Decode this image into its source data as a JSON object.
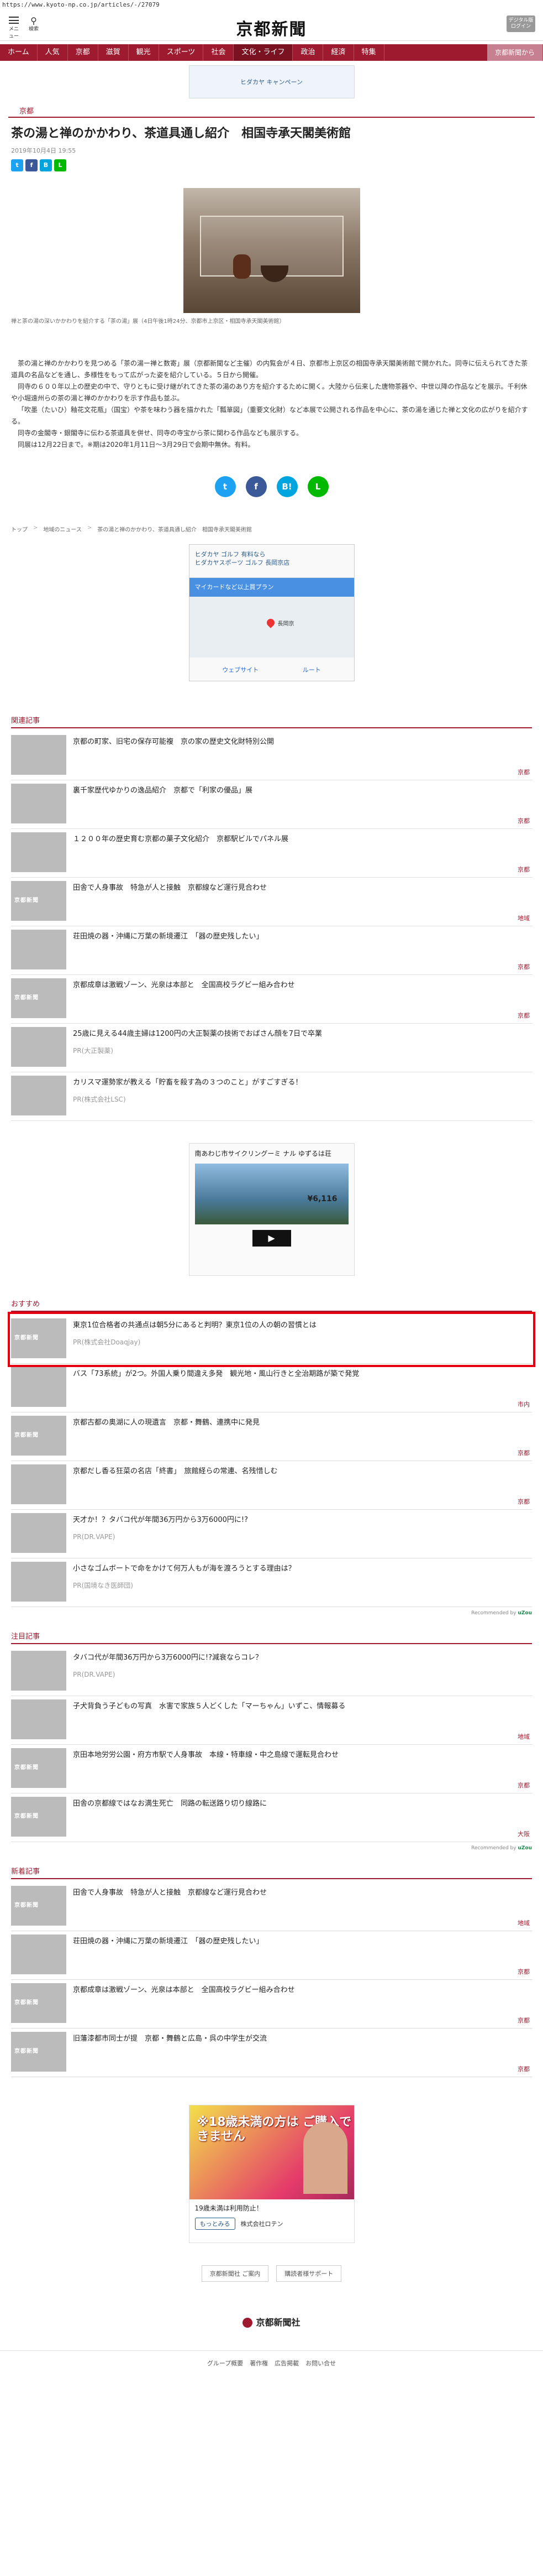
{
  "url": "https://www.kyoto-np.co.jp/articles/-/27079",
  "header": {
    "menu_label": "メニュー",
    "search_label": "検索",
    "logo": "京都新聞",
    "digital_label": "デジタル版 ログイン"
  },
  "nav": [
    "ホーム",
    "人気",
    "京都",
    "滋賀",
    "観光",
    "スポーツ",
    "社会",
    "文化・ライフ",
    "政治",
    "経済",
    "特集",
    "京都新聞から"
  ],
  "nav_active": 7,
  "top_banner": "ヒダカヤ キャンペーン",
  "section_label": "京都",
  "article": {
    "title": "茶の湯と禅のかかわり、茶道具通し紹介　相国寺承天閣美術館",
    "date": "2019年10月4日 19:55",
    "caption": "禅と茶の湯の深いかかわりを紹介する「茶の湯」展（4日午後1時24分、京都市上京区・相国寺承天閣美術館）",
    "paragraphs": [
      "茶の湯と禅のかかわりを見つめる「茶の湯ー禅と数寄」展（京都新聞など主催）の内覧会が４日、京都市上京区の相国寺承天閣美術館で開かれた。同寺に伝えられてきた茶道具の名品などを通し、多様性をもって広がった姿を紹介している。５日から開催。",
      "同寺の６００年以上の歴史の中で、守りともに受け継がれてきた茶の湯のあり方を紹介するために開く。大陸から伝来した唐物茶器や、中世以降の作品などを展示。千利休や小堀遠州らの茶の湯と禅のかかわりを示す作品も並ぶ。",
      "「吹墨（たいひ）釉花文花瓶」（国宝）や茶を味わう器を描かれた「瓢箪図」（重要文化財）など本展で公開される作品を中心に、茶の湯を通じた禅と文化の広がりを紹介する。",
      "同寺の金閣寺・銀閣寺に伝わる茶道具を併せ、同寺の寺宝から茶に関わる作品なども展示する。",
      "同展は12月22日まで。※期は2020年1月11日～3月29日で会期中無休。有料。"
    ]
  },
  "breadcrumb": [
    "トップ",
    "地域のニュース",
    "茶の湯と禅のかかわり、茶道具通し紹介　相国寺承天閣美術館"
  ],
  "ad_map": {
    "line1": "ヒダカヤ ゴルフ 有料なら",
    "line2": "ヒダカヤスポーツ ゴルフ 長岡京店",
    "blue": "マイカードなど以上買プラン",
    "map_label": "長岡京",
    "btn1": "ウェブサイト",
    "btn2": "ルート"
  },
  "related": {
    "title": "関連記事",
    "items": [
      {
        "text": "京都の町家、旧宅の保存可能複　京の家の歴史文化財特別公開",
        "cat": "京都",
        "thumb": "a"
      },
      {
        "text": "裏千家歴代ゆかりの逸品紹介　京都で「利家の優品」展",
        "cat": "京都",
        "thumb": "b"
      },
      {
        "text": "１２００年の歴史育む京都の菓子文化紹介　京都駅ビルでパネル展",
        "cat": "京都",
        "thumb": "c"
      },
      {
        "text": "田舎で人身事故　特急が人と接触　京都線など運行見合わせ",
        "cat": "地域",
        "thumb": "d"
      },
      {
        "text": "荘田焼の器・沖縄に万葉の新境遷江　「器の歴史残したい」",
        "cat": "京都",
        "thumb": "e"
      },
      {
        "text": "京都成章は激戦ゾーン、光泉は本部と　全国高校ラグビー組み合わせ",
        "cat": "京都",
        "thumb": "d"
      },
      {
        "text": "25歳に見える44歳主婦は1200円の大正製薬の技術でおばさん顔を7日で卒業",
        "cat": "PR(大正製薬)",
        "thumb": "g",
        "pr": true
      },
      {
        "text": "カリスマ運勢家が教える「貯畜を殺す為の３つのこと」がすごすぎる！",
        "cat": "PR(株式会社LSC)",
        "thumb": "h",
        "pr": true
      }
    ]
  },
  "ad_bike": {
    "text": "南あわじ市サイクリングーミ ナル ゆずるは荘",
    "price": "¥6,116",
    "go": "▶"
  },
  "recommend": {
    "title": "おすすめ",
    "items": [
      {
        "text": "東京1位合格者の共通点は朝5分にあると判明？東京1位の人の朝の習慣とは",
        "cat": "PR(株式会社Doaqjay)",
        "thumb": "d",
        "pr": true,
        "highlight": true
      },
      {
        "text": "バス「73系統」が2つ。外国人乗り間違え多発　観光地・風山行きと全治期路が築で発覚",
        "cat": "市内",
        "thumb": "f"
      },
      {
        "text": "京都古都の奥湖に人の現遺言　京都・舞鶴、連携中に発見",
        "cat": "京都",
        "thumb": "d"
      },
      {
        "text": "京都だし香る狂菜の名店「終書」　旅館経らの常連、名残惜しむ",
        "cat": "京都",
        "thumb": "b"
      },
      {
        "text": "天才か！？タバコ代が年間36万円から3万6000円に!?",
        "cat": "PR(DR.VAPE)",
        "thumb": "f",
        "pr": true
      },
      {
        "text": "小さなゴムボートで命をかけて何万人もが海を渡ろうとする理由は？",
        "cat": "PR(国境なき医師団)",
        "thumb": "c",
        "pr": true
      }
    ],
    "powered": "Recommended by",
    "brand": "uZou"
  },
  "attention": {
    "title": "注目記事",
    "items": [
      {
        "text": "タバコ代が年間36万円から3万6000円に!?減衰ならコレ？",
        "cat": "PR(DR.VAPE)",
        "thumb": "f",
        "pr": true
      },
      {
        "text": "子犬背負う子どもの写真　水害で家族５人どくした「マーちゃん」いずこ、情報募る",
        "cat": "地域",
        "thumb": "f"
      },
      {
        "text": "京田本地労労公園・府方市駅で人身事故　本線・特車線・中之島線で運転見合わせ",
        "cat": "京都",
        "thumb": "d"
      },
      {
        "text": "田舎の京都線ではなお満生死亡　同路の転送路り切り線路に",
        "cat": "大阪",
        "thumb": "d"
      }
    ],
    "powered": "Recommended by",
    "brand": "uZou"
  },
  "latest": {
    "title": "新着記事",
    "items": [
      {
        "text": "田舎で人身事故　特急が人と接触　京都線など運行見合わせ",
        "cat": "地域",
        "thumb": "d"
      },
      {
        "text": "荘田焼の器・沖縄に万葉の新境遷江　「器の歴史残したい」",
        "cat": "京都",
        "thumb": "e"
      },
      {
        "text": "京都成章は激戦ゾーン、光泉は本部と　全国高校ラグビー組み合わせ",
        "cat": "京都",
        "thumb": "d"
      },
      {
        "text": "旧藩漆都市同士が提　京都・舞鶴と広島・呉の中学生が交流",
        "cat": "京都",
        "thumb": "d"
      }
    ]
  },
  "ad_bottom": {
    "big": "※18歳未満の方は ご購入できません",
    "caption": "19歳未満は利用防止！",
    "more": "もっとみる",
    "sponsor": "株式会社ロテン"
  },
  "footer_links": [
    "京都新聞社 ご案内",
    "購読者様サポート"
  ],
  "footer_logo": "京都新聞社",
  "footer_bottom": [
    "グループ概要",
    "著作権",
    "広告掲載",
    "お問い合せ"
  ]
}
